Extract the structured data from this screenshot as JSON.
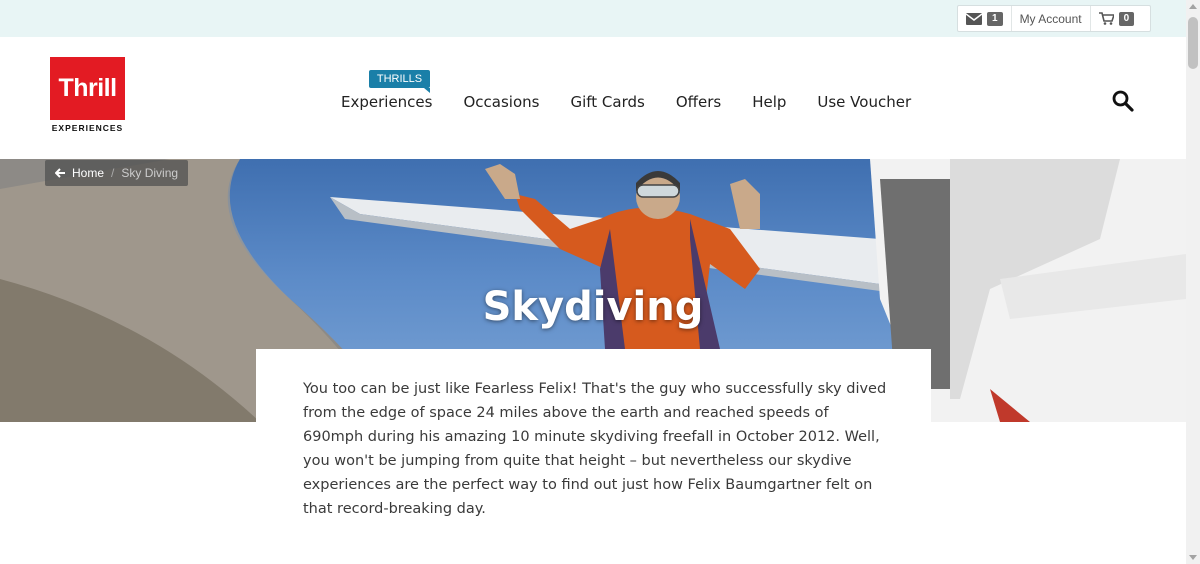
{
  "util_bar": {
    "mail_count": "1",
    "account_label": "My Account",
    "cart_count": "0"
  },
  "logo": {
    "name": "Thrill",
    "tagline": "EXPERIENCES"
  },
  "nav": {
    "tag": "THRILLS",
    "items": [
      "Experiences",
      "Occasions",
      "Gift Cards",
      "Offers",
      "Help",
      "Use Voucher"
    ]
  },
  "breadcrumb": {
    "home": "Home",
    "current": "Sky Diving"
  },
  "hero": {
    "title": "Skydiving"
  },
  "intro": {
    "text": "You too can be just like Fearless Felix! That's the guy who successfully sky dived from the edge of space 24 miles above the earth and reached speeds of 690mph during his amazing 10 minute skydiving freefall in October 2012. Well, you won't be jumping from quite that height – but nevertheless our skydive experiences are the perfect way to find out just how Felix Baumgartner felt on that record-breaking day."
  },
  "colors": {
    "brand_red": "#e31b23",
    "accent_blue": "#1a7fa8",
    "topbar_bg": "#e8f5f5"
  }
}
